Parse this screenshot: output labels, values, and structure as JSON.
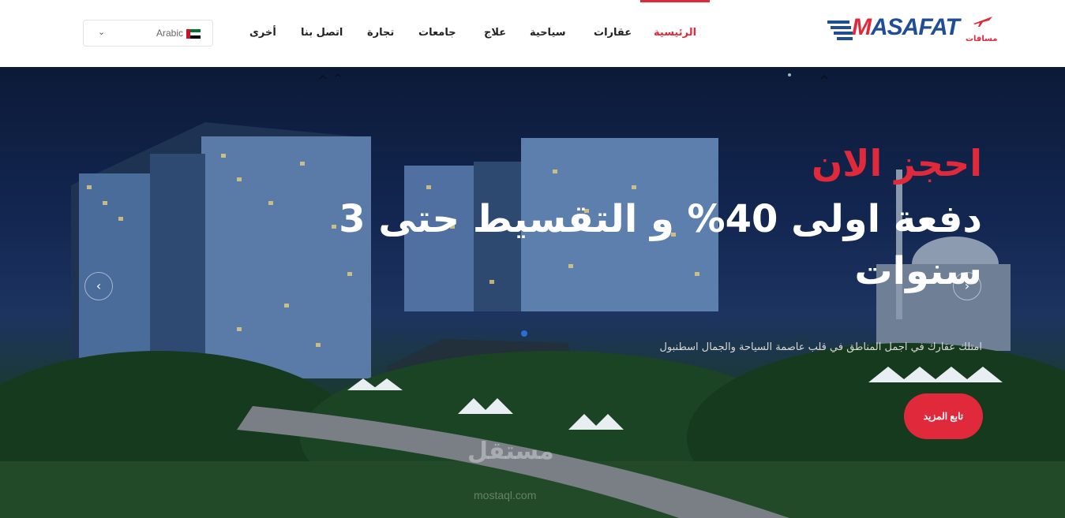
{
  "header": {
    "logo_text_m": "M",
    "logo_text_rest": "ASAFAT",
    "logo_sub": "مسافات",
    "language": {
      "selected": "Arabic",
      "flag": "uae-flag-icon"
    },
    "nav": [
      {
        "label": "الرئيسية",
        "active": true
      },
      {
        "label": "عقارات",
        "active": false
      },
      {
        "label": "سياحية",
        "active": false
      },
      {
        "label": "علاج",
        "active": false
      },
      {
        "label": "جامعات",
        "active": false
      },
      {
        "label": "تجارة",
        "active": false
      },
      {
        "label": "اتصل بنا",
        "active": false
      },
      {
        "label": "أخرى",
        "active": false
      }
    ]
  },
  "hero": {
    "headline_red": "احجز الان",
    "headline_white": "دفعة اولى 40% و التقسيط حتى 3 سنوات",
    "subline": "امتلك عقارك في اجمل المناطق في قلب عاصمة السياحة والجمال اسطنبول",
    "cta_label": "تابع المزيد",
    "prev_icon": "chevron-left-icon",
    "next_icon": "chevron-right-icon"
  },
  "watermark": {
    "text": "مستقل",
    "sub": "mostaql.com"
  },
  "colors": {
    "accent": "#e0293a",
    "brand_blue": "#1f4e96"
  }
}
